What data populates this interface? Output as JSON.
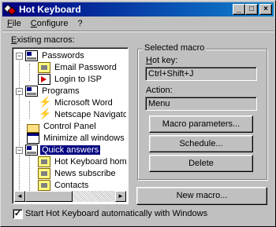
{
  "window": {
    "title": "Hot Keyboard"
  },
  "titlebar": {
    "minimize": "_",
    "maximize": "□",
    "close": "×"
  },
  "menu": {
    "file": {
      "accel": "F",
      "rest": "ile"
    },
    "configure": {
      "accel": "C",
      "rest": "onfigure"
    },
    "help": "?"
  },
  "macros": {
    "label_accel": "E",
    "label_rest": "xisting macros:",
    "tree": [
      {
        "label": "Passwords",
        "icon": "keyboard-icon",
        "expander": "−"
      },
      {
        "label": "Email Password",
        "icon": "mail-icon"
      },
      {
        "label": "Login to ISP",
        "icon": "run-icon"
      },
      {
        "label": "Programs",
        "icon": "keyboard-icon",
        "expander": "−"
      },
      {
        "label": "Microsoft Word",
        "icon": "lightning-icon"
      },
      {
        "label": "Netscape Navigator",
        "icon": "lightning-icon"
      },
      {
        "label": "Control Panel",
        "icon": "folder-icon"
      },
      {
        "label": "Minimize all windows",
        "icon": "window-icon"
      },
      {
        "label": "Quick answers",
        "icon": "keyboard-icon",
        "expander": "−",
        "selected": true
      },
      {
        "label": "Hot Keyboard homepa",
        "icon": "mail-icon"
      },
      {
        "label": "News subscribe",
        "icon": "mail-icon"
      },
      {
        "label": "Contacts",
        "icon": "mail-icon"
      }
    ],
    "scroll_left": "◄",
    "scroll_right": "►"
  },
  "selected_macro": {
    "title": "Selected macro",
    "hotkey_label_accel": "H",
    "hotkey_label_rest": "ot key:",
    "hotkey_value": "Ctrl+Shift+J",
    "action_label": "Action:",
    "action_value": "Menu",
    "parameters_button": "Macro parameters...",
    "schedule_button": "Schedule...",
    "delete_button": "Delete"
  },
  "new_macro_button": "New macro...",
  "autostart": {
    "checked": true,
    "mark": "✓",
    "label": "Start Hot Keyboard automatically with Windows"
  }
}
